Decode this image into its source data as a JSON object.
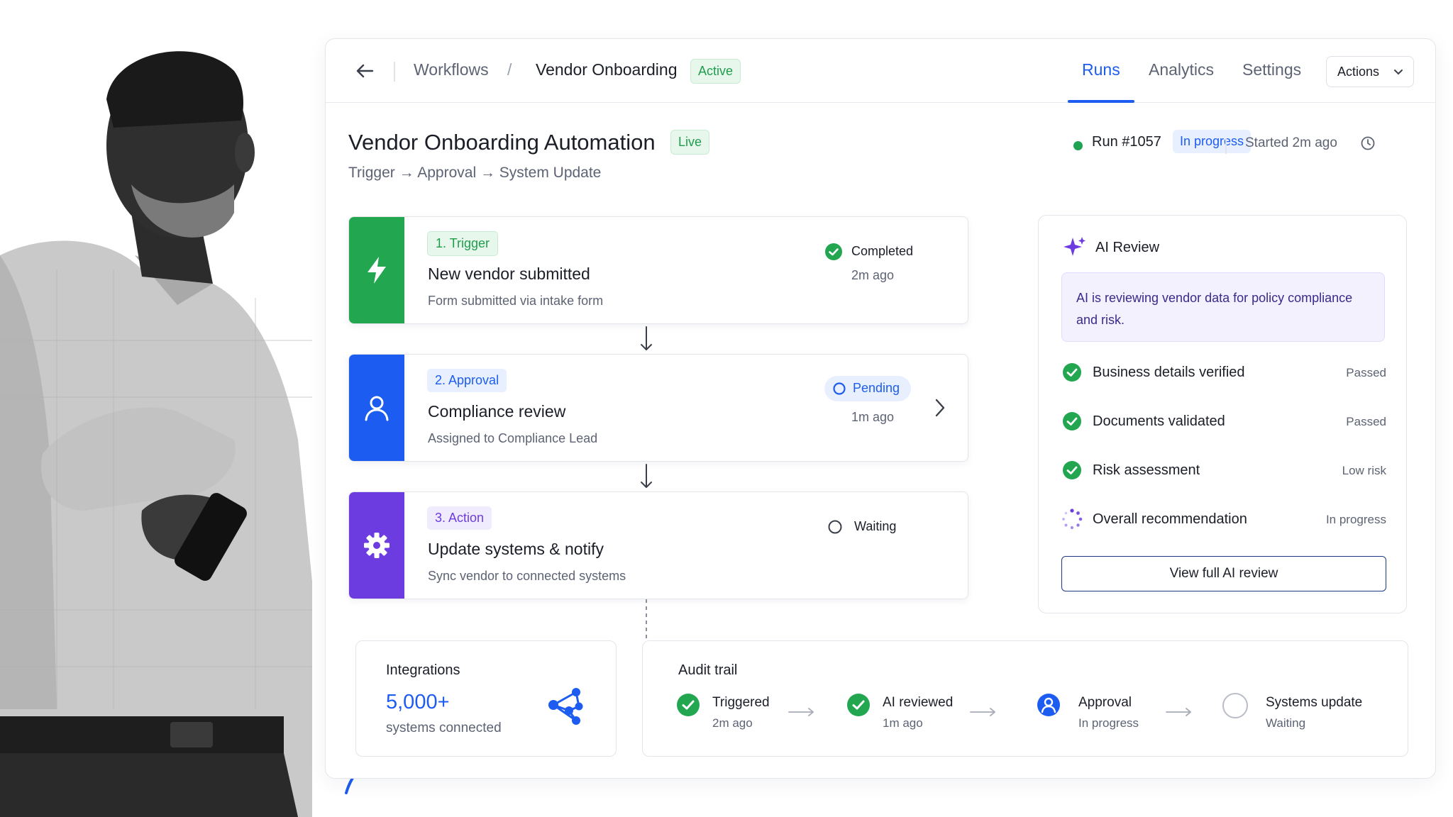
{
  "topbar": {
    "breadcrumb": [
      "Workflows",
      "Vendor Onboarding"
    ],
    "status_badge": "Active",
    "tabs": [
      {
        "label": "Runs",
        "active": true
      },
      {
        "label": "Analytics",
        "active": false
      },
      {
        "label": "Settings",
        "active": false
      }
    ],
    "actions_label": "Actions"
  },
  "header": {
    "title": "Vendor Onboarding Automation",
    "live_badge": "Live",
    "subtitle": "Trigger → Approval → System Update",
    "run_id": "Run #1057",
    "run_status": "In progress",
    "started": "Started 2m ago"
  },
  "steps": [
    {
      "chip": "1. Trigger",
      "title": "New vendor submitted",
      "desc": "Form submitted via intake form",
      "status": "Completed",
      "time": "2m ago",
      "color": "#22a650",
      "icon": "lightning-icon"
    },
    {
      "chip": "2. Approval",
      "title": "Compliance review",
      "desc": "Assigned to Compliance Lead",
      "status": "Pending",
      "time": "1m ago",
      "color": "#1d5cf0",
      "icon": "user-icon"
    },
    {
      "chip": "3. Action",
      "title": "Update systems & notify",
      "desc": "Sync vendor to connected systems",
      "status": "Waiting",
      "time": "",
      "color": "#6c3ce0",
      "icon": "gear-icon"
    }
  ],
  "ai_review": {
    "title": "AI Review",
    "note": "AI is reviewing vendor data for policy compliance and risk.",
    "checks": [
      {
        "label": "Business details verified",
        "value": "Passed",
        "state": "done"
      },
      {
        "label": "Documents validated",
        "value": "Passed",
        "state": "done"
      },
      {
        "label": "Risk assessment",
        "value": "Low risk",
        "state": "done"
      },
      {
        "label": "Overall recommendation",
        "value": "In progress",
        "state": "loading"
      }
    ],
    "button": "View full AI review"
  },
  "integrations": {
    "label": "Integrations",
    "count": "5,000+",
    "sub": "systems connected"
  },
  "audit": {
    "title": "Audit trail",
    "items": [
      {
        "label": "Triggered",
        "sub": "2m ago",
        "state": "done"
      },
      {
        "label": "AI reviewed",
        "sub": "1m ago",
        "state": "done"
      },
      {
        "label": "Approval",
        "sub": "In progress",
        "state": "current"
      },
      {
        "label": "Systems update",
        "sub": "Waiting",
        "state": "todo"
      }
    ]
  },
  "colors": {
    "accent": "#1d5cf0",
    "success": "#22a650",
    "purple": "#6c3ce0"
  }
}
